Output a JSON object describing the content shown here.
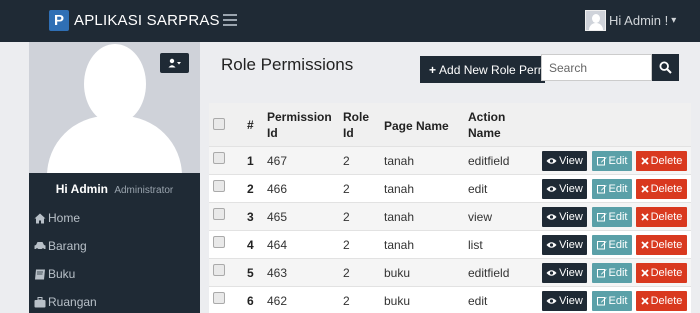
{
  "app": {
    "logo_letter": "P",
    "title": "APLIKASI SARPRAS",
    "user_menu": "Hi Admin !",
    "user_caret": "▾"
  },
  "sidebar": {
    "profile_name": "Hi Admin",
    "profile_role": "Administrator",
    "items": [
      {
        "label": "Home",
        "icon": "home-icon"
      },
      {
        "label": "Barang",
        "icon": "car-icon"
      },
      {
        "label": "Buku",
        "icon": "book-icon"
      },
      {
        "label": "Ruangan",
        "icon": "briefcase-icon"
      }
    ]
  },
  "page": {
    "title": "Role Permissions",
    "add_button": "Add New Role Permission",
    "search_placeholder": "Search"
  },
  "table": {
    "headers": {
      "num": "#",
      "permission_id_1": "Permission",
      "permission_id_2": "Id",
      "role_id_1": "Role",
      "role_id_2": "Id",
      "page_name": "Page Name",
      "action_name_1": "Action",
      "action_name_2": "Name"
    },
    "rows": [
      {
        "num": "1",
        "permission_id": "467",
        "role_id": "2",
        "page_name": "tanah",
        "action_name": "editfield"
      },
      {
        "num": "2",
        "permission_id": "466",
        "role_id": "2",
        "page_name": "tanah",
        "action_name": "edit"
      },
      {
        "num": "3",
        "permission_id": "465",
        "role_id": "2",
        "page_name": "tanah",
        "action_name": "view"
      },
      {
        "num": "4",
        "permission_id": "464",
        "role_id": "2",
        "page_name": "tanah",
        "action_name": "list"
      },
      {
        "num": "5",
        "permission_id": "463",
        "role_id": "2",
        "page_name": "buku",
        "action_name": "editfield"
      },
      {
        "num": "6",
        "permission_id": "462",
        "role_id": "2",
        "page_name": "buku",
        "action_name": "edit"
      }
    ],
    "actions": {
      "view": "View",
      "edit": "Edit",
      "delete": "Delete"
    }
  },
  "colors": {
    "dark": "#1f2a35",
    "edit": "#5aa0a8",
    "delete": "#d9391f"
  }
}
